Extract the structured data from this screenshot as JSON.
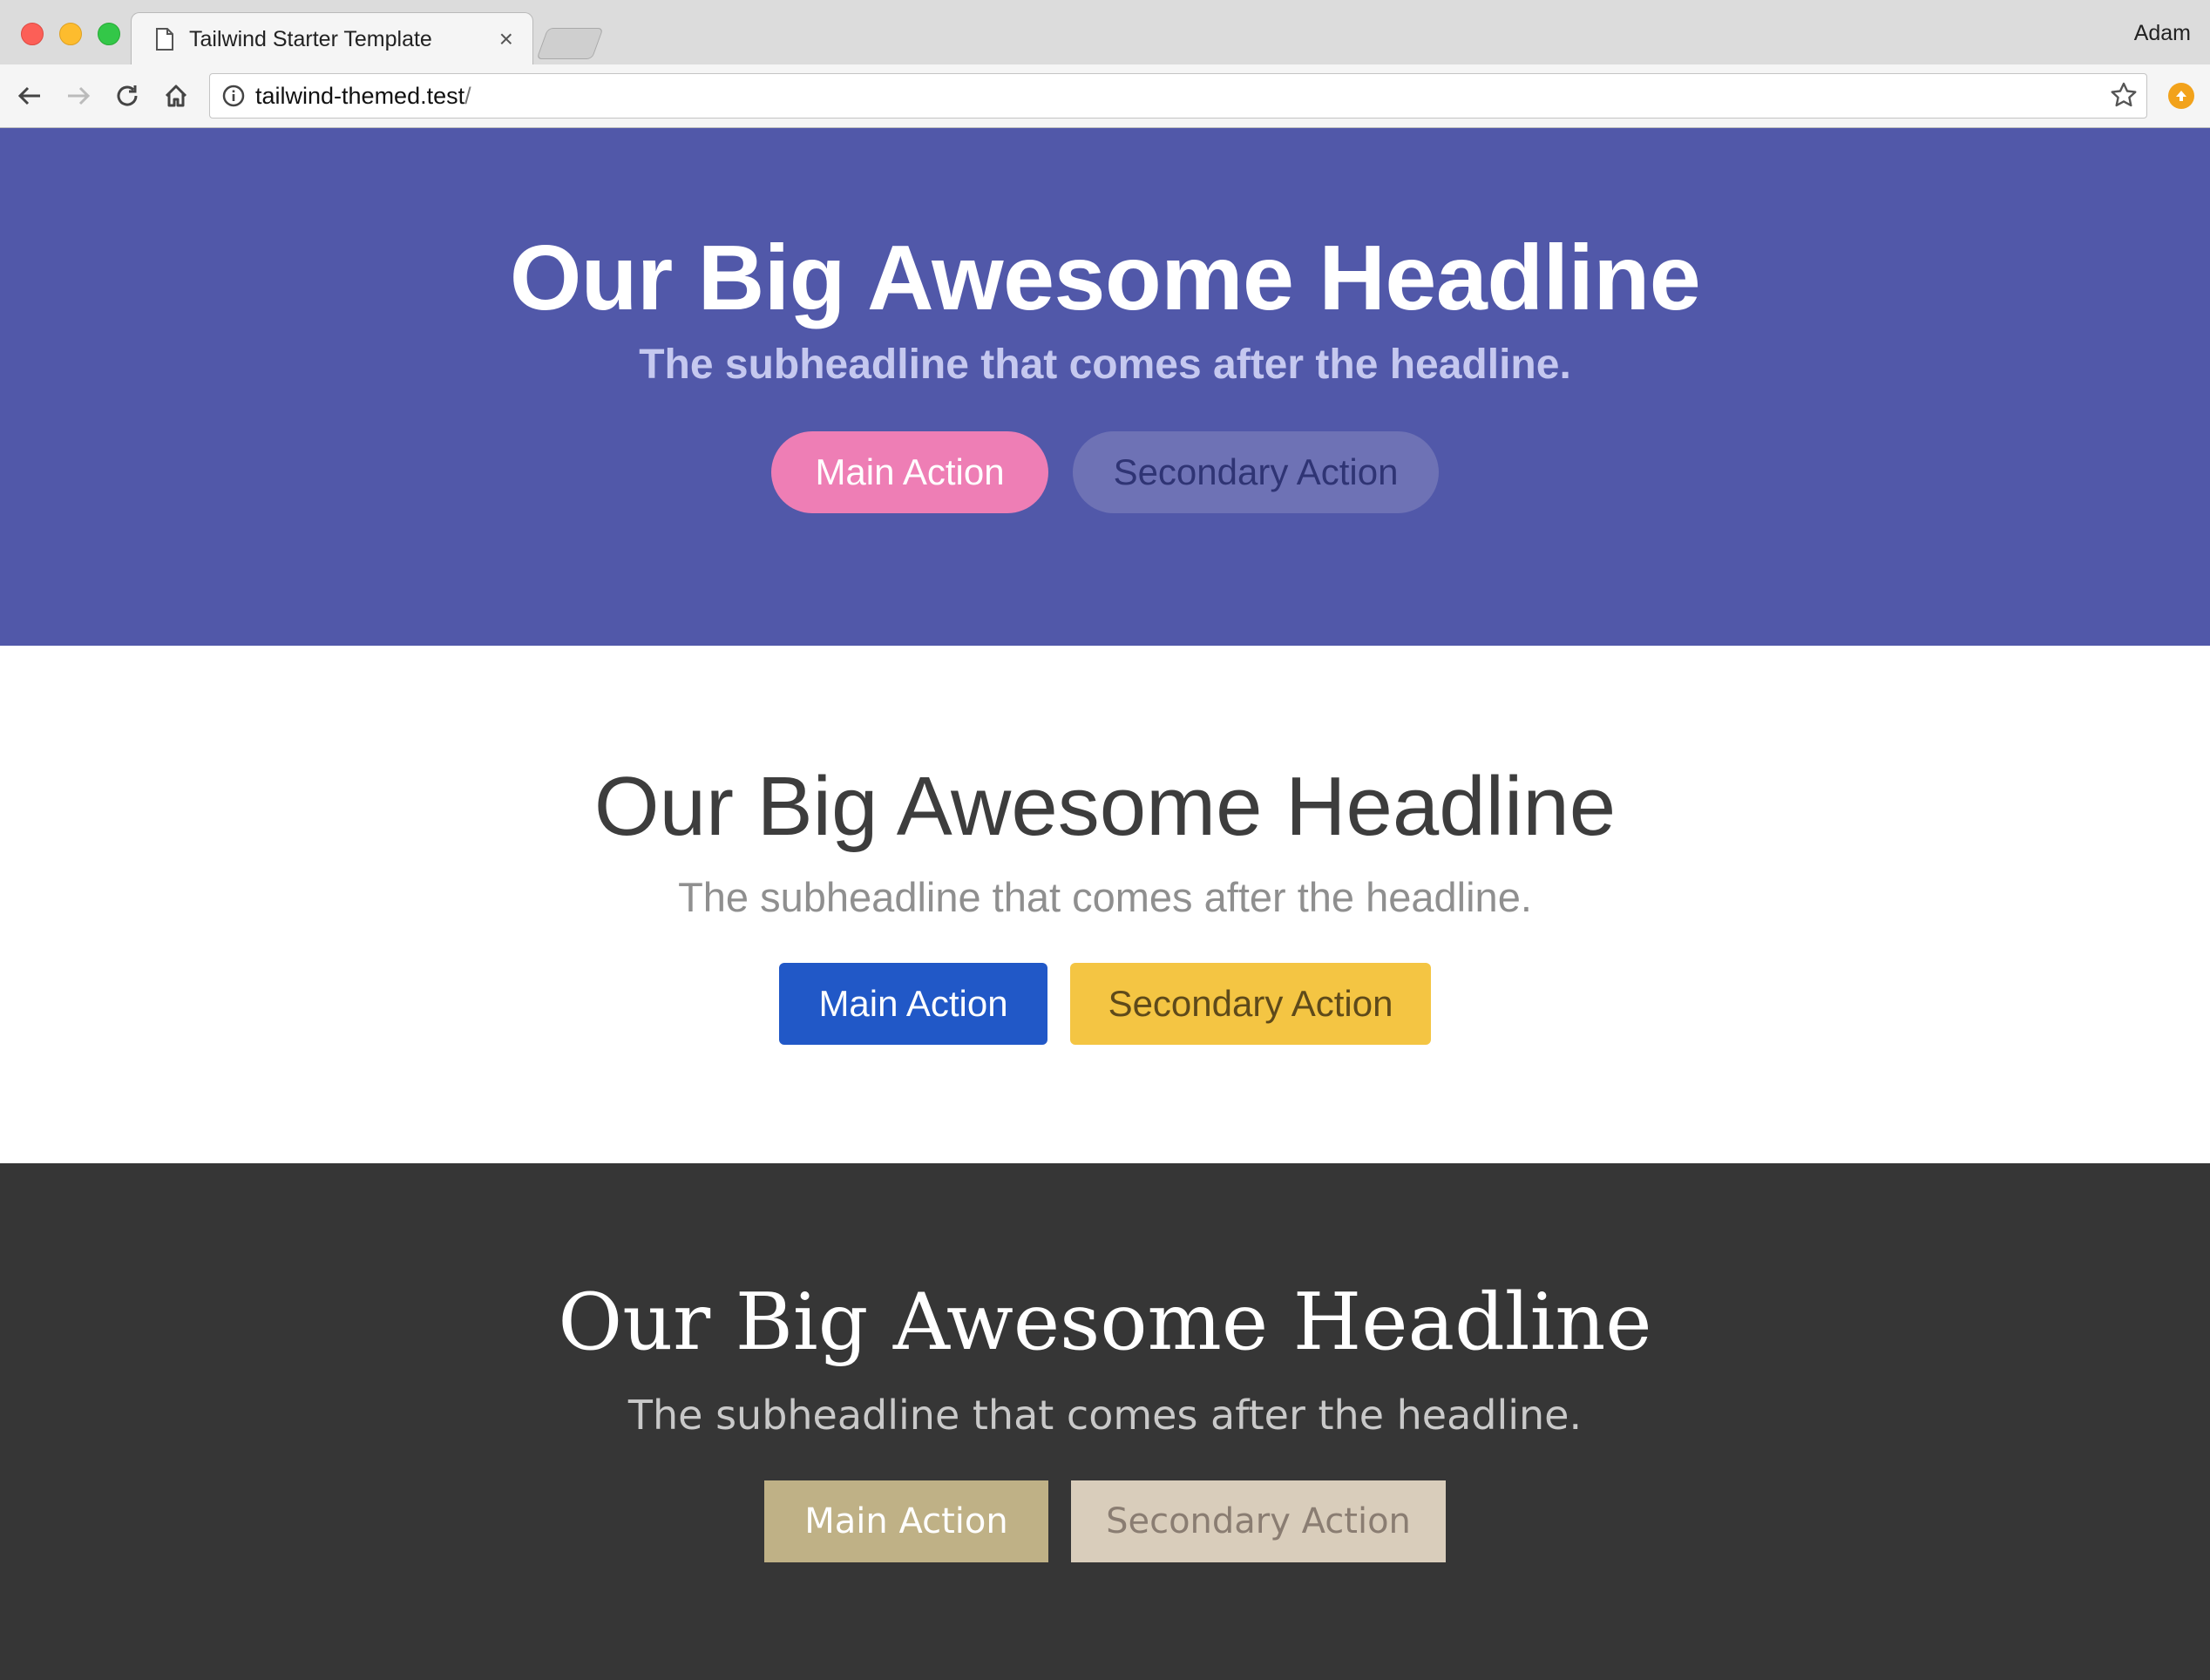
{
  "browser": {
    "tab_title": "Tailwind Starter Template",
    "tab_close": "×",
    "profile_name": "Adam",
    "url_host": "tailwind-themed.test",
    "url_path": "/"
  },
  "hero_purple": {
    "headline": "Our Big Awesome Headline",
    "subheadline": "The subheadline that comes after the headline.",
    "main_action": "Main Action",
    "secondary_action": "Secondary Action",
    "colors": {
      "background": "#5158a9",
      "main_button": "#ee7eb5",
      "secondary_button": "#6e72b5"
    }
  },
  "hero_white": {
    "headline": "Our Big Awesome Headline",
    "subheadline": "The subheadline that comes after the headline.",
    "main_action": "Main Action",
    "secondary_action": "Secondary Action",
    "colors": {
      "background": "#ffffff",
      "main_button": "#2158c7",
      "secondary_button": "#f4c543"
    }
  },
  "hero_dark": {
    "headline": "Our Big Awesome Headline",
    "subheadline": "The subheadline that comes after the headline.",
    "main_action": "Main Action",
    "secondary_action": "Secondary Action",
    "colors": {
      "background": "#363636",
      "main_button": "#bfb186",
      "secondary_button": "#d9cdbb"
    }
  },
  "icons": {
    "back": "arrow-left-icon",
    "forward": "arrow-right-icon",
    "reload": "reload-icon",
    "home": "home-icon",
    "info": "info-icon",
    "bookmark": "star-icon",
    "extension": "upload-extension-icon",
    "page": "document-icon"
  }
}
